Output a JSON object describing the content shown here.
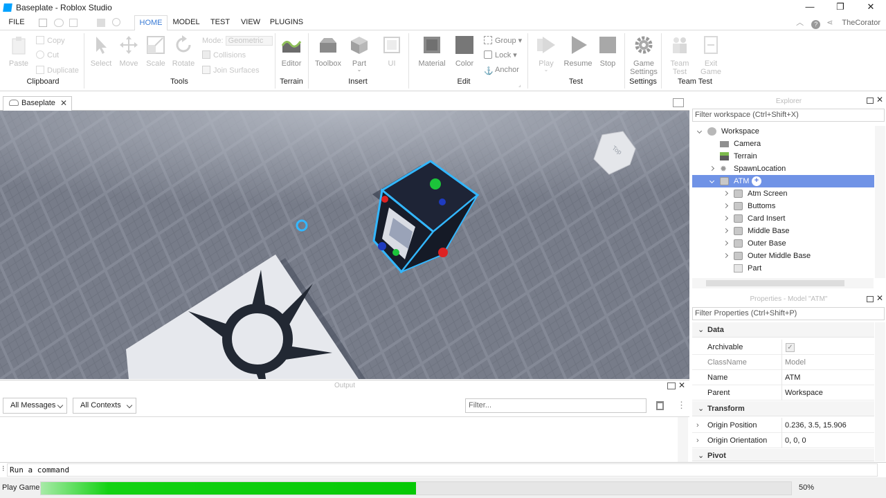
{
  "window": {
    "title": "Baseplate - Roblox Studio",
    "minimize": "—",
    "restore": "❐",
    "close": "✕"
  },
  "menu": {
    "items": [
      "FILE",
      "HOME",
      "MODEL",
      "TEST",
      "VIEW",
      "PLUGINS"
    ],
    "active": "HOME",
    "user": "TheCorator"
  },
  "ribbon": {
    "clipboard": {
      "paste": "Paste",
      "copy": "Copy",
      "cut": "Cut",
      "duplicate": "Duplicate",
      "group": "Clipboard"
    },
    "tools": {
      "select": "Select",
      "move": "Move",
      "scale": "Scale",
      "rotate": "Rotate",
      "mode_label": "Mode:",
      "mode_value": "Geometric",
      "collisions": "Collisions",
      "join_surfaces": "Join Surfaces",
      "group": "Tools"
    },
    "terrain": {
      "editor": "Editor",
      "group": "Terrain"
    },
    "insert": {
      "toolbox": "Toolbox",
      "part": "Part",
      "ui": "UI",
      "group": "Insert"
    },
    "edit": {
      "material": "Material",
      "color": "Color",
      "group_btn": "Group",
      "lock": "Lock",
      "anchor": "Anchor",
      "group": "Edit"
    },
    "test": {
      "play": "Play",
      "resume": "Resume",
      "stop": "Stop",
      "group": "Test"
    },
    "settings": {
      "game_settings_1": "Game",
      "game_settings_2": "Settings",
      "group": "Settings"
    },
    "team_test": {
      "team_test_1": "Team",
      "team_test_2": "Test",
      "exit_game_1": "Exit",
      "exit_game_2": "Game",
      "group": "Team Test"
    }
  },
  "doc_tab": {
    "label": "Baseplate"
  },
  "viewport": {
    "view_cube_label": "Top"
  },
  "output": {
    "title": "Output",
    "messages_filter": "All Messages",
    "contexts_filter": "All Contexts",
    "filter_placeholder": "Filter..."
  },
  "command": {
    "placeholder": "Run a command"
  },
  "status": {
    "label": "Play Game",
    "progress_percent": 50,
    "progress_text": "50%"
  },
  "explorer": {
    "title": "Explorer",
    "filter_placeholder": "Filter workspace (Ctrl+Shift+X)",
    "items": [
      {
        "label": "Workspace",
        "icon": "globe-icon"
      },
      {
        "label": "Camera",
        "icon": "camera-icon"
      },
      {
        "label": "Terrain",
        "icon": "terrain-icon"
      },
      {
        "label": "SpawnLocation",
        "icon": "spawn-icon"
      },
      {
        "label": "ATM",
        "icon": "model-icon"
      },
      {
        "label": "Atm Screen",
        "icon": "model-icon"
      },
      {
        "label": "Buttoms",
        "icon": "model-icon"
      },
      {
        "label": "Card Insert",
        "icon": "model-icon"
      },
      {
        "label": "Middle Base",
        "icon": "model-icon"
      },
      {
        "label": "Outer Base",
        "icon": "model-icon"
      },
      {
        "label": "Outer Middle Base",
        "icon": "model-icon"
      },
      {
        "label": "Part",
        "icon": "part-icon"
      }
    ]
  },
  "properties": {
    "title": "Properties - Model \"ATM\"",
    "filter_placeholder": "Filter Properties (Ctrl+Shift+P)",
    "sections": {
      "data": "Data",
      "transform": "Transform",
      "pivot": "Pivot"
    },
    "rows": {
      "archivable": {
        "k": "Archivable",
        "checked": true
      },
      "classname": {
        "k": "ClassName",
        "v": "Model"
      },
      "name": {
        "k": "Name",
        "v": "ATM"
      },
      "parent": {
        "k": "Parent",
        "v": "Workspace"
      },
      "origin_position": {
        "k": "Origin Position",
        "v": "0.236, 3.5, 15.906"
      },
      "origin_orientation": {
        "k": "Origin Orientation",
        "v": "0, 0, 0"
      }
    }
  }
}
